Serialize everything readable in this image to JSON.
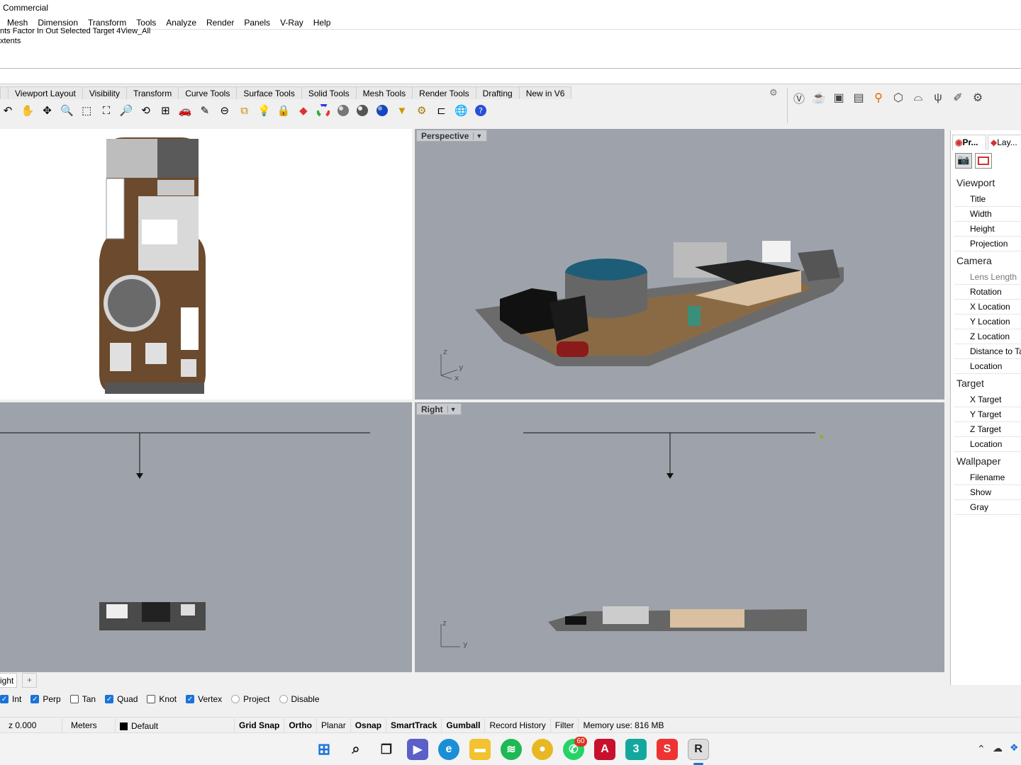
{
  "window": {
    "title": "Commercial"
  },
  "menu": [
    "Mesh",
    "Dimension",
    "Transform",
    "Tools",
    "Analyze",
    "Render",
    "Panels",
    "V-Ray",
    "Help"
  ],
  "command_history": [
    "nts Factor In Out Selected Target 4View_All",
    "xtents"
  ],
  "toolbar_tabs": [
    "Viewport Layout",
    "Visibility",
    "Transform",
    "Curve Tools",
    "Surface Tools",
    "Solid Tools",
    "Mesh Tools",
    "Render Tools",
    "Drafting",
    "New in V6"
  ],
  "tool_icons": [
    "rotate-view-icon",
    "pan-hand-icon",
    "move-icon",
    "zoom-icon",
    "zoom-window-icon",
    "zoom-extents-icon",
    "zoom-selected-icon",
    "rotate-camera-icon",
    "four-viewports-icon",
    "car-icon",
    "properties-icon",
    "circle-dash-icon",
    "snapshot-icon",
    "light-bulb-icon",
    "lock-icon",
    "layer-icon",
    "color-wheel-icon",
    "shaded-sphere-icon",
    "rendered-sphere-icon",
    "blue-sphere-icon",
    "spotlight-icon",
    "gear-settings-icon",
    "dimension-icon",
    "globe-icon",
    "help-icon"
  ],
  "right_tool_icons": [
    "vray-icon",
    "teapot-icon",
    "frame-buffer-icon",
    "asset-editor-icon",
    "lights-icon",
    "cube-proxy-icon",
    "fur-icon",
    "grass-icon",
    "brush-icon",
    "settings-icon"
  ],
  "viewports": {
    "perspective": {
      "label": "Perspective",
      "axes": [
        "z",
        "y",
        "x"
      ]
    },
    "right": {
      "label": "Right",
      "axes": [
        "z",
        "y"
      ]
    }
  },
  "panel": {
    "tabs": [
      "Pr...",
      "Lay..."
    ],
    "sections": [
      {
        "title": "Viewport",
        "rows": [
          "Title",
          "Width",
          "Height",
          "Projection"
        ]
      },
      {
        "title": "Camera",
        "rows": [
          "Lens Length",
          "Rotation",
          "X Location",
          "Y Location",
          "Z Location",
          "Distance to Ta",
          "Location"
        ]
      },
      {
        "title": "Target",
        "rows": [
          "X Target",
          "Y Target",
          "Z Target",
          "Location"
        ]
      },
      {
        "title": "Wallpaper",
        "rows": [
          "Filename",
          "Show",
          "Gray"
        ]
      }
    ]
  },
  "viewport_tab": {
    "label": "ight",
    "add": "+"
  },
  "osnaps": [
    {
      "label": "Int",
      "checked": true
    },
    {
      "label": "Perp",
      "checked": true
    },
    {
      "label": "Tan",
      "checked": false
    },
    {
      "label": "Quad",
      "checked": true
    },
    {
      "label": "Knot",
      "checked": false
    },
    {
      "label": "Vertex",
      "checked": true
    },
    {
      "label": "Project",
      "checked": false
    },
    {
      "label": "Disable",
      "checked": false
    }
  ],
  "status": {
    "coord": "z 0.000",
    "units": "Meters",
    "layer": "Default",
    "grid_snap": "Grid Snap",
    "ortho": "Ortho",
    "planar": "Planar",
    "osnap": "Osnap",
    "smarttrack": "SmartTrack",
    "gumball": "Gumball",
    "record_history": "Record History",
    "filter": "Filter",
    "memory": "Memory use: 816 MB"
  },
  "taskbar": {
    "icons": [
      "windows-start-icon",
      "search-icon",
      "task-view-icon",
      "teams-icon",
      "edge-icon",
      "file-explorer-icon",
      "spotify-icon",
      "chrome-icon",
      "whatsapp-icon",
      "acrobat-icon",
      "3dsmax-icon",
      "sketchup-icon",
      "rhino-icon"
    ],
    "whatsapp_badge": "60"
  },
  "colors": {
    "viewport_bg": "#9ea3ab",
    "top_viewport_bg": "#ffffff",
    "accent": "#1a73d9"
  }
}
